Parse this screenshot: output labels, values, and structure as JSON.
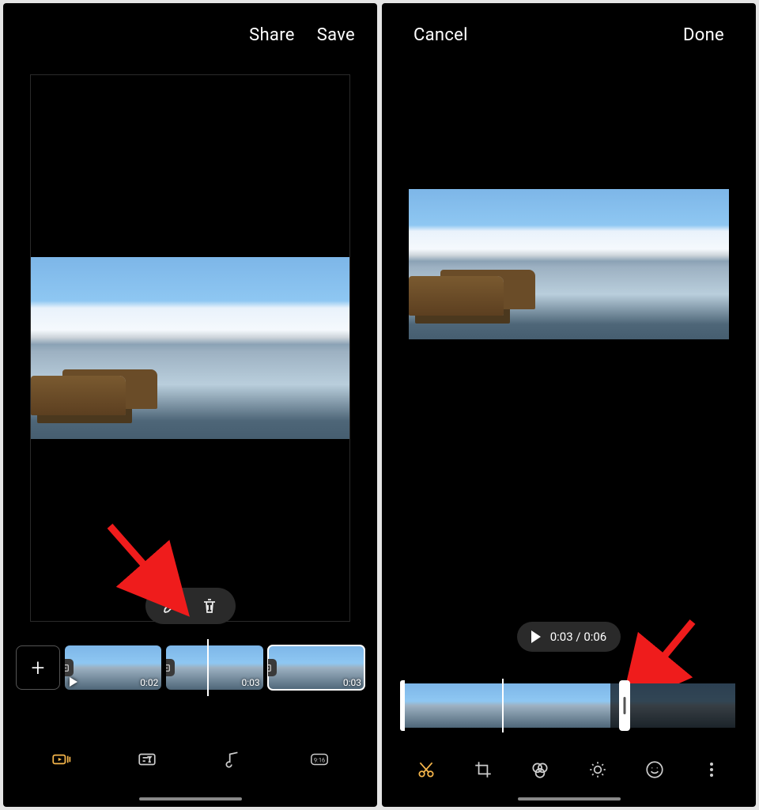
{
  "left": {
    "top": {
      "share": "Share",
      "save": "Save"
    },
    "clips": [
      {
        "duration": "0:02"
      },
      {
        "duration": "0:03"
      },
      {
        "duration": "0:03"
      }
    ],
    "tools": {
      "timeline": "timeline",
      "caption": "caption",
      "music": "music",
      "aspect": "9:16"
    }
  },
  "right": {
    "top": {
      "cancel": "Cancel",
      "done": "Done"
    },
    "playback": {
      "current": "0:03",
      "total": "0:06",
      "sep": " / "
    },
    "tools": {
      "trim": "trim",
      "crop": "crop",
      "filter": "filter",
      "adjust": "adjust",
      "sticker": "sticker",
      "more": "more"
    }
  }
}
